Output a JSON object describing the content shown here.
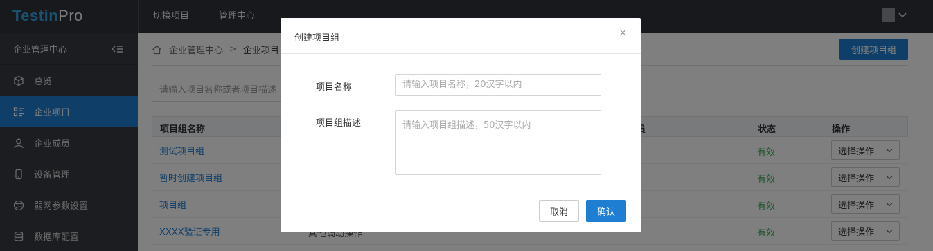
{
  "app": {
    "logo_main": "Testin",
    "logo_suffix": "Pro"
  },
  "topnav": {
    "items": [
      {
        "label": "切换项目"
      },
      {
        "label": "管理中心"
      }
    ]
  },
  "sidebar": {
    "header": "企业管理中心",
    "items": [
      {
        "label": "总览",
        "icon": "cube-icon"
      },
      {
        "label": "企业项目",
        "icon": "list-grid-icon",
        "active": true
      },
      {
        "label": "企业成员",
        "icon": "user-icon"
      },
      {
        "label": "设备管理",
        "icon": "phone-icon"
      },
      {
        "label": "弱网参数设置",
        "icon": "globe-icon"
      },
      {
        "label": "数据库配置",
        "icon": "database-icon"
      }
    ]
  },
  "breadcrumb": {
    "root": "企业管理中心",
    "current": "企业项目"
  },
  "toolbar": {
    "create_label": "创建项目组"
  },
  "search": {
    "placeholder": "请输入项目名称或者项目描述"
  },
  "table": {
    "headers": {
      "name": "项目组名称",
      "members": "成员",
      "status": "状态",
      "ops": "操作"
    },
    "rows": [
      {
        "name": "测试项目组",
        "desc": "",
        "status": "有效",
        "op": "选择操作"
      },
      {
        "name": "暂时创建项目组",
        "desc": "",
        "status": "有效",
        "op": "选择操作"
      },
      {
        "name": "项目组",
        "desc": "",
        "status": "有效",
        "op": "选择操作"
      },
      {
        "name": "XXXX验证专用",
        "desc": "其他调动操作",
        "status": "有效",
        "op": "选择操作"
      }
    ]
  },
  "modal": {
    "title": "创建项目组",
    "close_glyph": "×",
    "name_label": "项目名称",
    "name_placeholder": "请输入项目名称，20汉字以内",
    "desc_label": "项目组描述",
    "desc_placeholder": "请输入项目组描述，50汉字以内",
    "cancel_label": "取消",
    "ok_label": "确认"
  },
  "colors": {
    "primary": "#1e7fd2",
    "topbar": "#2f333b",
    "sidebar": "#363b43",
    "status_ok": "#3aaa5a"
  }
}
